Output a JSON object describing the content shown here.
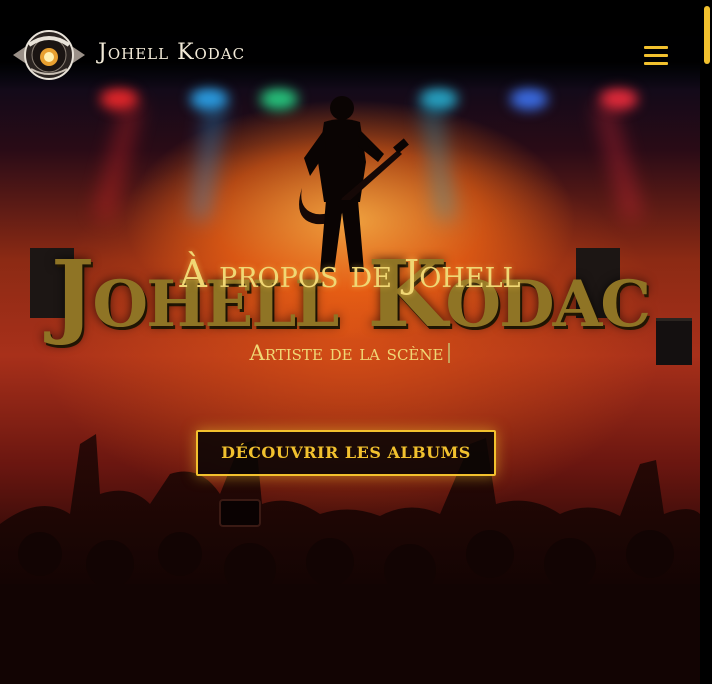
{
  "header": {
    "site_title": "Johell Kodac",
    "logo_icon": "johell-kodac-logo-badge",
    "menu_icon": "hamburger-menu-icon"
  },
  "hero": {
    "brand_art_text": "Johell Kodac",
    "heading": "À propos de Johell",
    "subtitle": "Artiste de la scène",
    "cta_label": "DÉCOUVRIR LES ALBUMS"
  },
  "colors": {
    "accent": "#f2c12e",
    "heading_gold": "#f0d774",
    "brand_art_gold": "#8f7425",
    "header_bg": "#000000",
    "title_text": "#f2ead8"
  },
  "scrollbar": {
    "icon": "scrollbar-thumb"
  }
}
